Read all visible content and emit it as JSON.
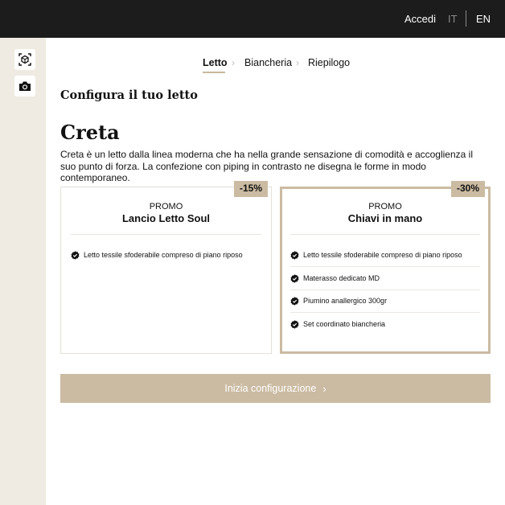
{
  "header": {
    "login_label": "Accedi",
    "lang_it": "IT",
    "lang_en": "EN"
  },
  "sidebar": {
    "ar_icon": "ar-view-icon",
    "camera_icon": "camera-icon"
  },
  "steps": [
    {
      "label": "Letto",
      "active": true
    },
    {
      "label": "Biancheria",
      "active": false
    },
    {
      "label": "Riepilogo",
      "active": false
    }
  ],
  "page": {
    "config_title": "Configura il tuo letto",
    "product_name": "Creta",
    "description": "Creta è un letto dalla linea moderna che ha nella grande sensazione di comodità e accoglienza il suo punto di forza. La confezione con piping in contrasto ne disegna le forme in modo contemporaneo."
  },
  "cards": [
    {
      "discount": "-15%",
      "promo_label": "PROMO",
      "name": "Lancio Letto Soul",
      "features": [
        "Letto tessile sfoderabile compreso di piano riposo"
      ]
    },
    {
      "discount": "-30%",
      "promo_label": "PROMO",
      "name": "Chiavi in mano",
      "features": [
        "Letto tessile sfoderabile compreso di piano riposo",
        "Materasso dedicato MD",
        "Piumino anallergico 300gr",
        "Set coordinato biancheria"
      ]
    }
  ],
  "cta": {
    "label": "Inizia configurazione",
    "arrow": "›"
  },
  "colors": {
    "accent": "#cbbba2",
    "topbar": "#1c1c1c",
    "sidebar": "#f0ebe2"
  }
}
